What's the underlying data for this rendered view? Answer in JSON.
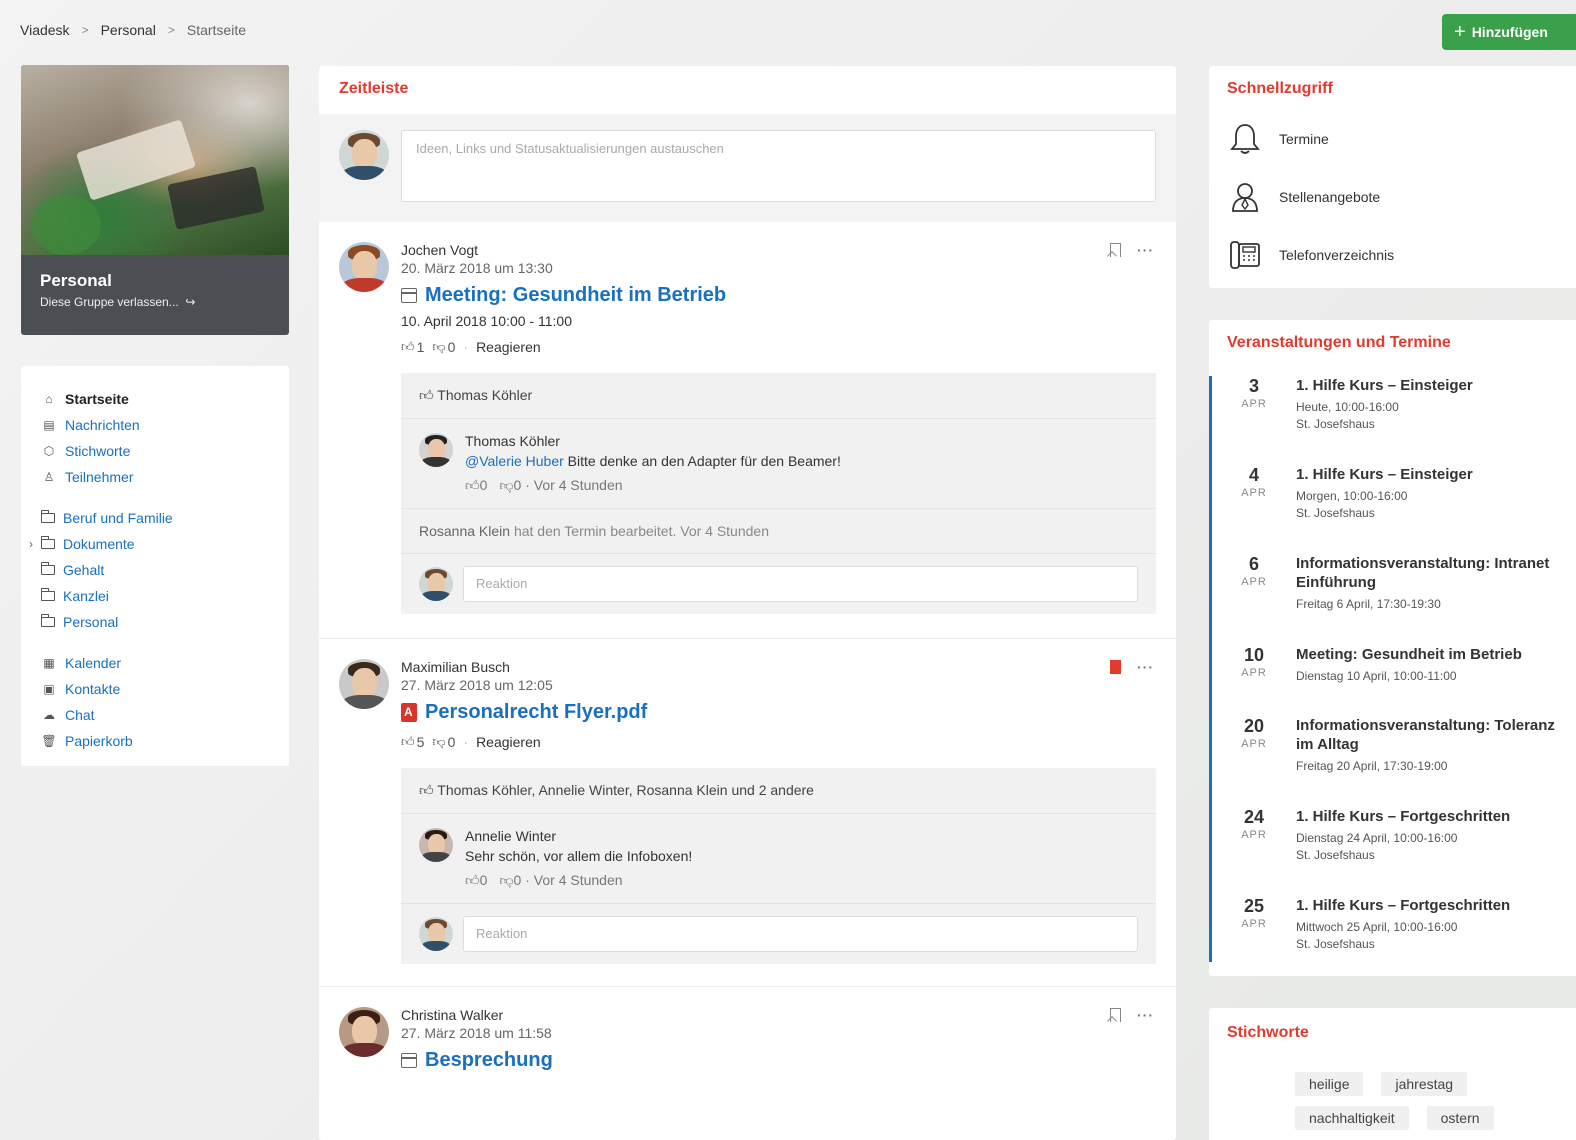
{
  "breadcrumb": [
    "Viadesk",
    "Personal",
    "Startseite"
  ],
  "add_button": "Hinzufügen",
  "group": {
    "title": "Personal",
    "leave_link": "Diese Gruppe verlassen..."
  },
  "nav": {
    "main": [
      {
        "label": "Startseite",
        "icon": "home-icon"
      },
      {
        "label": "Nachrichten",
        "icon": "news-icon"
      },
      {
        "label": "Stichworte",
        "icon": "tag-icon"
      },
      {
        "label": "Teilnehmer",
        "icon": "user-icon"
      }
    ],
    "folders": [
      "Beruf und Familie",
      "Dokumente",
      "Gehalt",
      "Kanzlei",
      "Personal"
    ],
    "tools": [
      {
        "label": "Kalender",
        "icon": "calendar-icon"
      },
      {
        "label": "Kontakte",
        "icon": "contacts-icon"
      },
      {
        "label": "Chat",
        "icon": "chat-icon"
      },
      {
        "label": "Papierkorb",
        "icon": "trash-icon"
      }
    ]
  },
  "timeline": {
    "title": "Zeitleiste",
    "composer_placeholder": "Ideen, Links und Statusaktualisierungen austauschen",
    "reply_placeholder": "Reaktion",
    "react_label": "Reagieren",
    "posts": [
      {
        "author": "Jochen Vogt",
        "date": "20. März 2018 um 13:30",
        "title": "Meeting: Gesundheit im Betrieb",
        "subtitle": "10. April 2018 10:00 - 11:00",
        "likes": "1",
        "dislikes": "0",
        "liked_by": "Thomas Köhler",
        "comment": {
          "author": "Thomas Köhler",
          "mention": "@Valerie Huber",
          "text": "Bitte denke an den Adapter für den Beamer!",
          "likes": "0",
          "dislikes": "0",
          "time": "Vor 4 Stunden"
        },
        "activity": {
          "actor": "Rosanna Klein",
          "text": "hat den Termin bearbeitet.",
          "time": "Vor 4 Stunden"
        }
      },
      {
        "author": "Maximilian Busch",
        "date": "27. März 2018 um 12:05",
        "title": "Personalrecht Flyer.pdf",
        "likes": "5",
        "dislikes": "0",
        "liked_by": "Thomas Köhler, Annelie Winter, Rosanna Klein und 2 andere",
        "comment": {
          "author": "Annelie Winter",
          "text": "Sehr schön, vor allem die Infoboxen!",
          "likes": "0",
          "dislikes": "0",
          "time": "Vor 4 Stunden"
        }
      },
      {
        "author": "Christina Walker",
        "date": "27. März 2018 um 11:58",
        "title": "Besprechung"
      }
    ]
  },
  "quick_access": {
    "title": "Schnellzugriff",
    "items": [
      {
        "label": "Termine",
        "icon": "bell-icon"
      },
      {
        "label": "Stellenangebote",
        "icon": "job-icon"
      },
      {
        "label": "Telefonverzeichnis",
        "icon": "phone-icon"
      }
    ]
  },
  "events": {
    "title": "Veranstaltungen und Termine",
    "items": [
      {
        "day": "3",
        "month": "APR",
        "title": "1. Hilfe Kurs – Einsteiger",
        "line1": "Heute, 10:00-16:00",
        "line2": "St. Josefshaus"
      },
      {
        "day": "4",
        "month": "APR",
        "title": "1. Hilfe Kurs – Einsteiger",
        "line1": "Morgen, 10:00-16:00",
        "line2": "St. Josefshaus"
      },
      {
        "day": "6",
        "month": "APR",
        "title": "Informationsveranstaltung: Intranet Einführung",
        "line1": "Freitag 6 April, 17:30-19:30",
        "line2": ""
      },
      {
        "day": "10",
        "month": "APR",
        "title": "Meeting: Gesundheit im Betrieb",
        "line1": "Dienstag 10 April, 10:00-11:00",
        "line2": ""
      },
      {
        "day": "20",
        "month": "APR",
        "title": "Informationsveranstaltung: Toleranz im Alltag",
        "line1": "Freitag 20 April, 17:30-19:00",
        "line2": ""
      },
      {
        "day": "24",
        "month": "APR",
        "title": "1. Hilfe Kurs – Fortgeschritten",
        "line1": "Dienstag 24 April, 10:00-16:00",
        "line2": "St. Josefshaus"
      },
      {
        "day": "25",
        "month": "APR",
        "title": "1. Hilfe Kurs – Fortgeschritten",
        "line1": "Mittwoch 25 April, 10:00-16:00",
        "line2": "St. Josefshaus"
      }
    ]
  },
  "tags": {
    "title": "Stichworte",
    "items": [
      "heilige",
      "jahrestag",
      "nachhaltigkeit",
      "ostern"
    ]
  },
  "colors": {
    "accent_red": "#e23a2e",
    "link_blue": "#1a6fbf",
    "add_green": "#3aa14a"
  }
}
